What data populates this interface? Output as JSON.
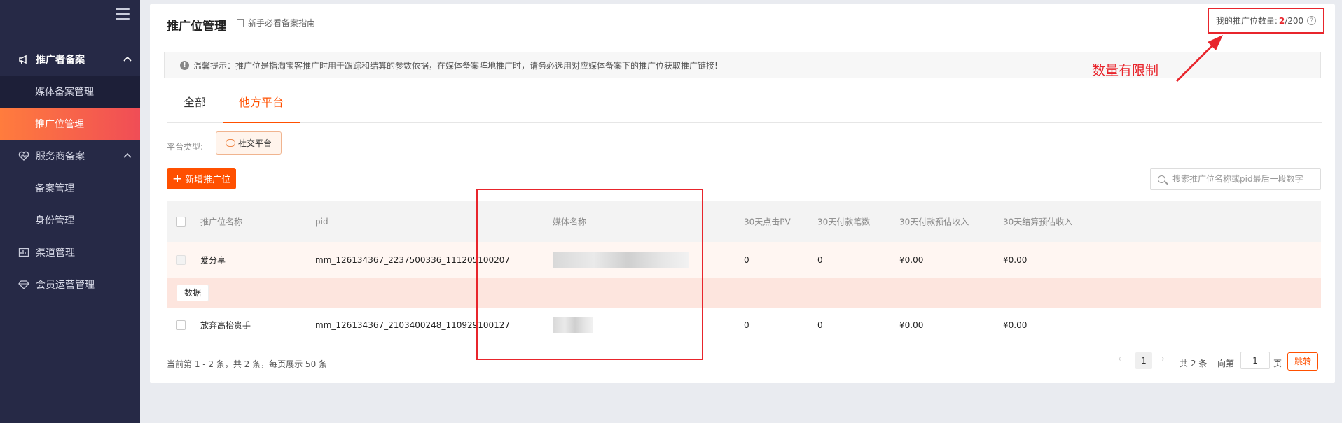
{
  "sidebar": {
    "groups": [
      {
        "label": "推广者备案",
        "icon": "megaphone-icon"
      },
      {
        "label": "服务商备案",
        "icon": "heart-icon"
      },
      {
        "label": "渠道管理",
        "icon": "channel-icon"
      },
      {
        "label": "会员运营管理",
        "icon": "diamond-icon"
      }
    ],
    "subs": [
      {
        "label": "媒体备案管理"
      },
      {
        "label": "推广位管理"
      },
      {
        "label": "备案管理"
      },
      {
        "label": "身份管理"
      }
    ]
  },
  "header": {
    "title": "推广位管理",
    "guide_link": "新手必看备案指南",
    "quota_label": "我的推广位数量:",
    "quota_used": "2",
    "quota_total": "/200"
  },
  "notice": "温馨提示：推广位是指淘宝客推广时用于跟踪和结算的参数依据，在媒体备案阵地推广时，请务必选用对应媒体备案下的推广位获取推广链接!",
  "annotation": "数量有限制",
  "tabs": [
    {
      "label": "全部"
    },
    {
      "label": "他方平台"
    }
  ],
  "filter": {
    "label": "平台类型:",
    "chip": "社交平台"
  },
  "toolbar": {
    "add_label": "新增推广位",
    "search_placeholder": "搜索推广位名称或pid最后一段数字"
  },
  "table": {
    "columns": [
      "推广位名称",
      "pid",
      "媒体名称",
      "30天点击PV",
      "30天付款笔数",
      "30天付款预估收入",
      "30天结算预估收入"
    ],
    "rows": [
      {
        "name": "爱分享",
        "pid": "mm_126134367_2237500336_111205100207",
        "pv": "0",
        "orders": "0",
        "pay_income": "¥0.00",
        "settle_income": "¥0.00"
      },
      {
        "name": "放弃高抬贵手",
        "pid": "mm_126134367_2103400248_110929100127",
        "pv": "0",
        "orders": "0",
        "pay_income": "¥0.00",
        "settle_income": "¥0.00"
      }
    ],
    "data_button": "数据"
  },
  "pagination": {
    "summary": "当前第 1 - 2 条，共 2 条，每页展示 50 条",
    "current": "1",
    "total": "共 2 条",
    "goto": "向第",
    "goto_value": "1",
    "page_unit": "页",
    "jump": "跳转"
  },
  "colors": {
    "accent": "#ff5000",
    "sidebar_bg": "#262946",
    "highlight": "#e8252c"
  }
}
